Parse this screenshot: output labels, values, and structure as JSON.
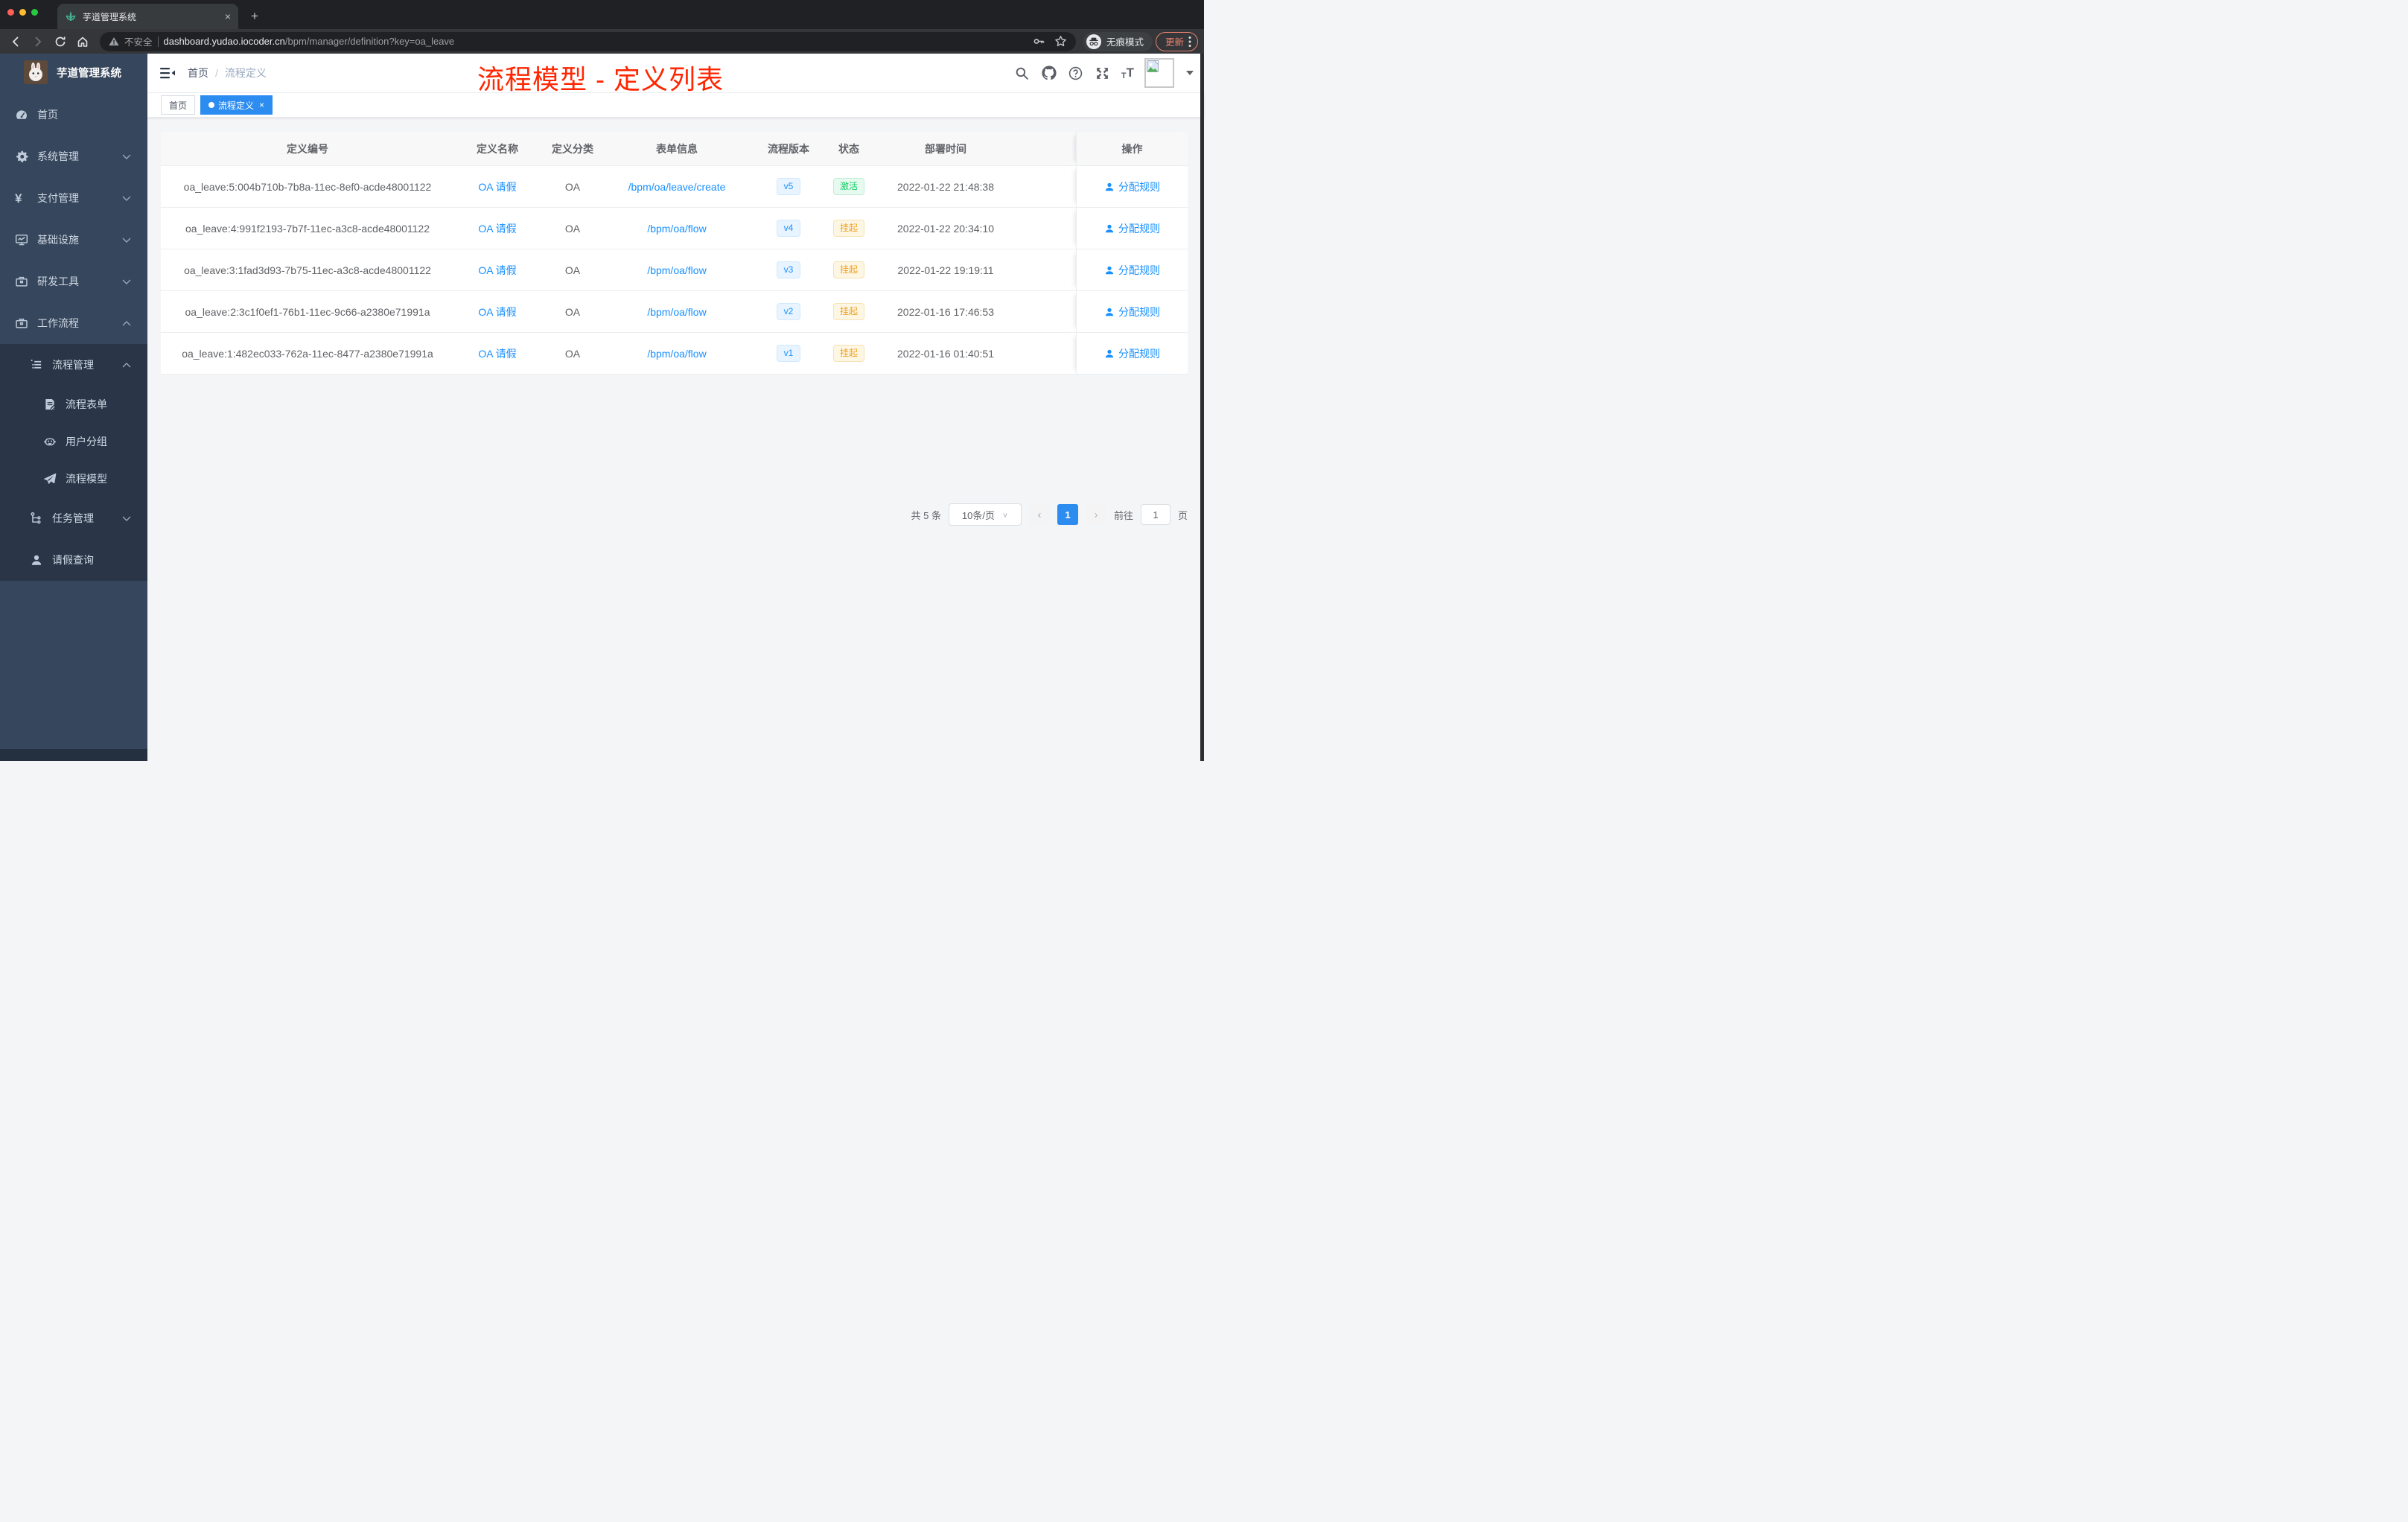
{
  "browser": {
    "tab": {
      "title": "芋道管理系统"
    },
    "address": {
      "security_label": "不安全",
      "domain": "dashboard.yudao.iocoder.cn",
      "path": "/bpm/manager/definition?key=oa_leave"
    },
    "incognito_label": "无痕模式",
    "update_label": "更新"
  },
  "sidebar": {
    "logo_title": "芋道管理系统",
    "menu": [
      {
        "label": "首页",
        "icon": "dashboard-icon"
      },
      {
        "label": "系统管理",
        "icon": "gear-icon"
      },
      {
        "label": "支付管理",
        "icon": "yen-icon"
      },
      {
        "label": "基础设施",
        "icon": "monitor-icon"
      },
      {
        "label": "研发工具",
        "icon": "toolbox-icon"
      },
      {
        "label": "工作流程",
        "icon": "briefcase-icon",
        "expanded": true
      }
    ],
    "workflow_submenu": [
      {
        "label": "流程管理",
        "icon": "list-icon",
        "expanded": true
      },
      {
        "label": "流程表单",
        "icon": "form-icon"
      },
      {
        "label": "用户分组",
        "icon": "group-icon"
      },
      {
        "label": "流程模型",
        "icon": "paper-plane-icon"
      },
      {
        "label": "任务管理",
        "icon": "task-tree-icon"
      },
      {
        "label": "请假查询",
        "icon": "user-icon"
      }
    ]
  },
  "navbar": {
    "breadcrumb": [
      "首页",
      "流程定义"
    ],
    "breadcrumb_separator": "/",
    "annotation": "流程模型 - 定义列表"
  },
  "tags_view": [
    {
      "label": "首页",
      "active": false
    },
    {
      "label": "流程定义",
      "active": true
    }
  ],
  "table": {
    "columns": [
      "定义编号",
      "定义名称",
      "定义分类",
      "表单信息",
      "流程版本",
      "状态",
      "部署时间",
      "操作"
    ],
    "rows": [
      {
        "id": "oa_leave:5:004b710b-7b8a-11ec-8ef0-acde48001122",
        "name": "OA 请假",
        "category": "OA",
        "form": "/bpm/oa/leave/create",
        "version": "v5",
        "status": {
          "label": "激活",
          "type": "success"
        },
        "deploy_time": "2022-01-22 21:48:38"
      },
      {
        "id": "oa_leave:4:991f2193-7b7f-11ec-a3c8-acde48001122",
        "name": "OA 请假",
        "category": "OA",
        "form": "/bpm/oa/flow",
        "version": "v4",
        "status": {
          "label": "挂起",
          "type": "warning"
        },
        "deploy_time": "2022-01-22 20:34:10"
      },
      {
        "id": "oa_leave:3:1fad3d93-7b75-11ec-a3c8-acde48001122",
        "name": "OA 请假",
        "category": "OA",
        "form": "/bpm/oa/flow",
        "version": "v3",
        "status": {
          "label": "挂起",
          "type": "warning"
        },
        "deploy_time": "2022-01-22 19:19:11"
      },
      {
        "id": "oa_leave:2:3c1f0ef1-76b1-11ec-9c66-a2380e71991a",
        "name": "OA 请假",
        "category": "OA",
        "form": "/bpm/oa/flow",
        "version": "v2",
        "status": {
          "label": "挂起",
          "type": "warning"
        },
        "deploy_time": "2022-01-16 17:46:53"
      },
      {
        "id": "oa_leave:1:482ec033-762a-11ec-8477-a2380e71991a",
        "name": "OA 请假",
        "category": "OA",
        "form": "/bpm/oa/flow",
        "version": "v1",
        "status": {
          "label": "挂起",
          "type": "warning"
        },
        "deploy_time": "2022-01-16 01:40:51"
      }
    ]
  },
  "actions": {
    "assign_rule_label": "分配规则"
  },
  "pagination": {
    "total_label": "共 5 条",
    "page_size_label": "10条/页",
    "prev_label": "‹",
    "next_label": "›",
    "current_page": "1",
    "goto_prefix": "前往",
    "goto_value": "1",
    "goto_suffix": "页"
  },
  "colors": {
    "primary": "#1890ff",
    "tag_active_bg": "#2d8cf0",
    "success_text": "#13ce66",
    "warning_text": "#f0a020",
    "annotation_red": "#ff2600",
    "sidebar_bg": "#36465c",
    "sidebar_submenu_bg": "#2a3648",
    "chrome_bg": "#202124",
    "update_chip": "#e8826d"
  }
}
